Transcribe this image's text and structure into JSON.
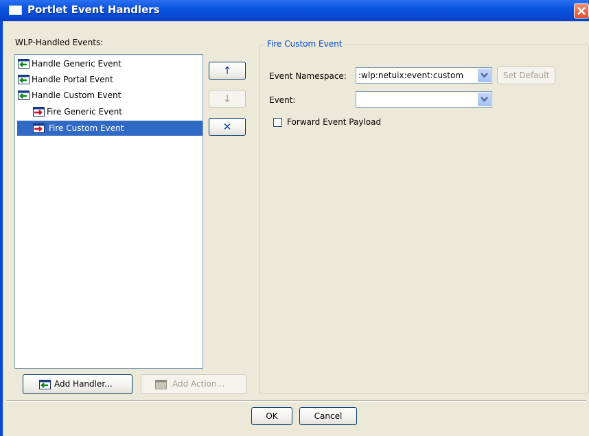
{
  "window": {
    "title": "Portlet Event Handlers",
    "accent": "#0a54e0"
  },
  "left": {
    "heading": "WLP-Handled Events:",
    "items": [
      {
        "label": "Handle Generic Event",
        "icon": "handle-event-icon",
        "selected": false
      },
      {
        "label": "Handle Portal Event",
        "icon": "handle-event-icon",
        "selected": false
      },
      {
        "label": "Handle Custom Event",
        "icon": "handle-event-icon",
        "selected": false
      },
      {
        "label": "Fire Generic Event",
        "icon": "fire-event-icon",
        "selected": false
      },
      {
        "label": "Fire Custom Event",
        "icon": "fire-event-icon",
        "selected": true
      }
    ],
    "add_handler": "Add Handler...",
    "add_action": "Add Action..."
  },
  "side_buttons": {
    "up": "↑",
    "down": "↓",
    "remove": "✕"
  },
  "group": {
    "title": "Fire Custom Event",
    "namespace_label": "Event Namespace:",
    "namespace_value": ":wlp:netuix:event:custom",
    "set_default": "Set Default",
    "event_label": "Event:",
    "event_value": "",
    "forward_label": "Forward Event Payload",
    "forward_checked": false
  },
  "footer": {
    "ok": "OK",
    "cancel": "Cancel"
  },
  "colors": {
    "selection": "#316ac5",
    "dialog_bg": "#ece9d8"
  }
}
